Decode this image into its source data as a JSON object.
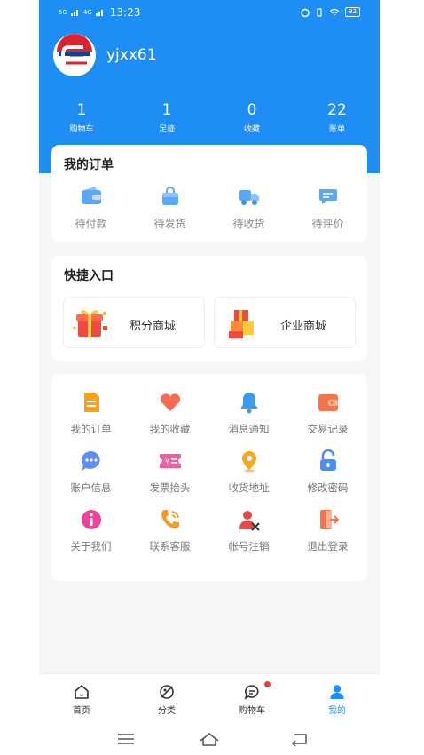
{
  "status_bar": {
    "network": "5G",
    "network2": "4G",
    "time": "13:23",
    "battery": "92"
  },
  "user": {
    "name": "yjxx61"
  },
  "stats": [
    {
      "num": "1",
      "label": "购物车"
    },
    {
      "num": "1",
      "label": "足迹"
    },
    {
      "num": "0",
      "label": "收藏"
    },
    {
      "num": "22",
      "label": "账单"
    }
  ],
  "orders": {
    "title": "我的订单",
    "items": [
      {
        "label": "待付款",
        "icon": "wallet-icon"
      },
      {
        "label": "待发货",
        "icon": "bag-icon"
      },
      {
        "label": "待收货",
        "icon": "truck-icon"
      },
      {
        "label": "待评价",
        "icon": "comment-icon"
      }
    ]
  },
  "quick": {
    "title": "快捷入口",
    "items": [
      {
        "label": "积分商城",
        "icon": "gift-box-icon"
      },
      {
        "label": "企业商城",
        "icon": "boxes-icon"
      }
    ]
  },
  "menu": [
    {
      "label": "我的订单",
      "icon": "document-icon",
      "color": "#f7a21b"
    },
    {
      "label": "我的收藏",
      "icon": "heart-icon",
      "color": "#f56b53"
    },
    {
      "label": "消息通知",
      "icon": "bell-icon",
      "color": "#3a9bf2"
    },
    {
      "label": "交易记录",
      "icon": "wallet-record-icon",
      "color": "#f4744b"
    },
    {
      "label": "账户信息",
      "icon": "chat-bubble-icon",
      "color": "#5d8df7"
    },
    {
      "label": "发票抬头",
      "icon": "invoice-icon",
      "color": "#f05fa0"
    },
    {
      "label": "收货地址",
      "icon": "location-pin-icon",
      "color": "#f5a623"
    },
    {
      "label": "修改密码",
      "icon": "lock-icon",
      "color": "#4b8ef5"
    },
    {
      "label": "关于我们",
      "icon": "info-icon",
      "color": "#f0429a"
    },
    {
      "label": "联系客服",
      "icon": "phone-icon",
      "color": "#f59a23"
    },
    {
      "label": "帐号注销",
      "icon": "user-remove-icon",
      "color": "#e94747"
    },
    {
      "label": "退出登录",
      "icon": "exit-icon",
      "color": "#f4744b"
    }
  ],
  "tabs": [
    {
      "label": "首页",
      "icon": "home-icon"
    },
    {
      "label": "分类",
      "icon": "category-icon"
    },
    {
      "label": "购物车",
      "icon": "cart-chat-icon"
    },
    {
      "label": "我的",
      "icon": "profile-icon"
    }
  ],
  "colors": {
    "primary": "#1e8ef5",
    "badge": "#f03c3c"
  }
}
